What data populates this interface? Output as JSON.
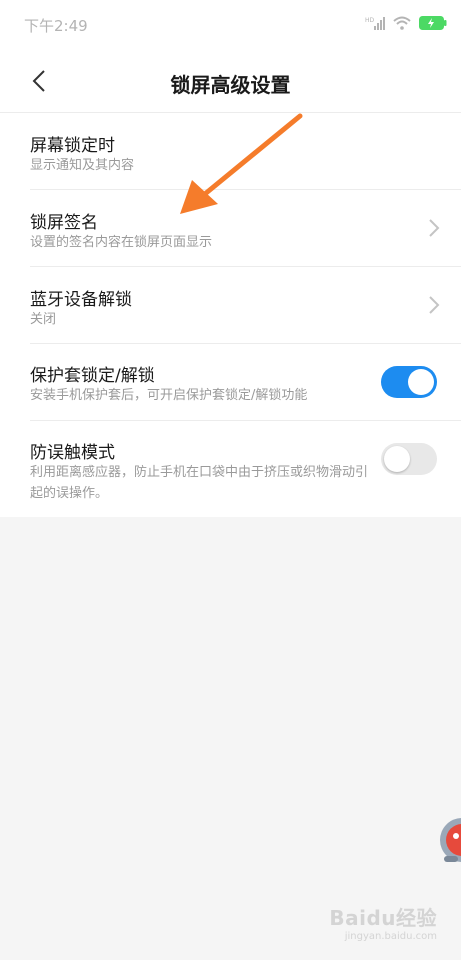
{
  "status_bar": {
    "time": "下午2:49",
    "network_label": "HD",
    "battery_color": "#4cd964"
  },
  "header": {
    "title": "锁屏高级设置",
    "back_icon": "chevron-left-icon"
  },
  "settings": {
    "items": [
      {
        "title": "屏幕锁定时",
        "subtitle": "显示通知及其内容",
        "control": "none"
      },
      {
        "title": "锁屏签名",
        "subtitle": "设置的签名内容在锁屏页面显示",
        "control": "chevron"
      },
      {
        "title": "蓝牙设备解锁",
        "subtitle": "关闭",
        "control": "chevron"
      },
      {
        "title": "保护套锁定/解锁",
        "subtitle": "安装手机保护套后，可开启保护套锁定/解锁功能",
        "control": "toggle",
        "enabled": true
      },
      {
        "title": "防误触模式",
        "subtitle": "利用距离感应器，防止手机在口袋中由于挤压或织物滑动引起的误操作。",
        "control": "toggle",
        "enabled": false
      }
    ]
  },
  "colors": {
    "toggle_on": "#1d8cf0",
    "toggle_off": "#e8e8e8",
    "annotation_arrow": "#f57c2b"
  },
  "watermark": {
    "logo": "Baidu经验",
    "sub": "jingyan.baidu.com"
  }
}
